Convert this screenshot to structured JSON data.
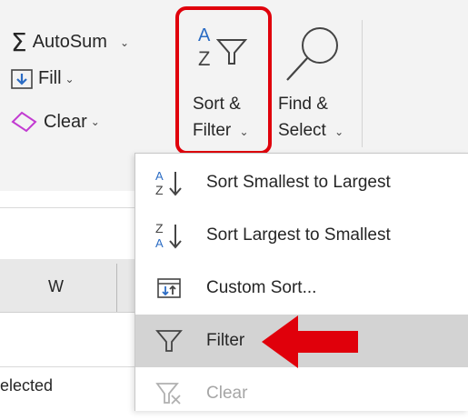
{
  "ribbon": {
    "autosum_label": "AutoSum",
    "autosum_symbol": "Σ",
    "fill_label": "Fill",
    "clear_label": "Clear",
    "sort_filter_line1": "Sort &",
    "sort_filter_line2": "Filter",
    "find_select_line1": "Find &",
    "find_select_line2": "Select",
    "chevron": "⌄",
    "sort_icon_a": "A",
    "sort_icon_z": "Z"
  },
  "menu": {
    "items": [
      {
        "label": "Sort Smallest to Largest",
        "icon": "sort-ascending-icon",
        "state": "normal"
      },
      {
        "label": "Sort Largest to Smallest",
        "icon": "sort-descending-icon",
        "state": "normal"
      },
      {
        "label": "Custom Sort...",
        "icon": "custom-sort-icon",
        "state": "normal"
      },
      {
        "label": "Filter",
        "icon": "filter-icon",
        "state": "hover"
      },
      {
        "label": "Clear",
        "icon": "clear-filter-icon",
        "state": "disabled"
      }
    ]
  },
  "sheet": {
    "column_label": "W",
    "cell_text": "elected"
  },
  "colors": {
    "highlight": "#e0000b",
    "accent_blue": "#2b6cc4",
    "clear_pink": "#c23bd1"
  }
}
